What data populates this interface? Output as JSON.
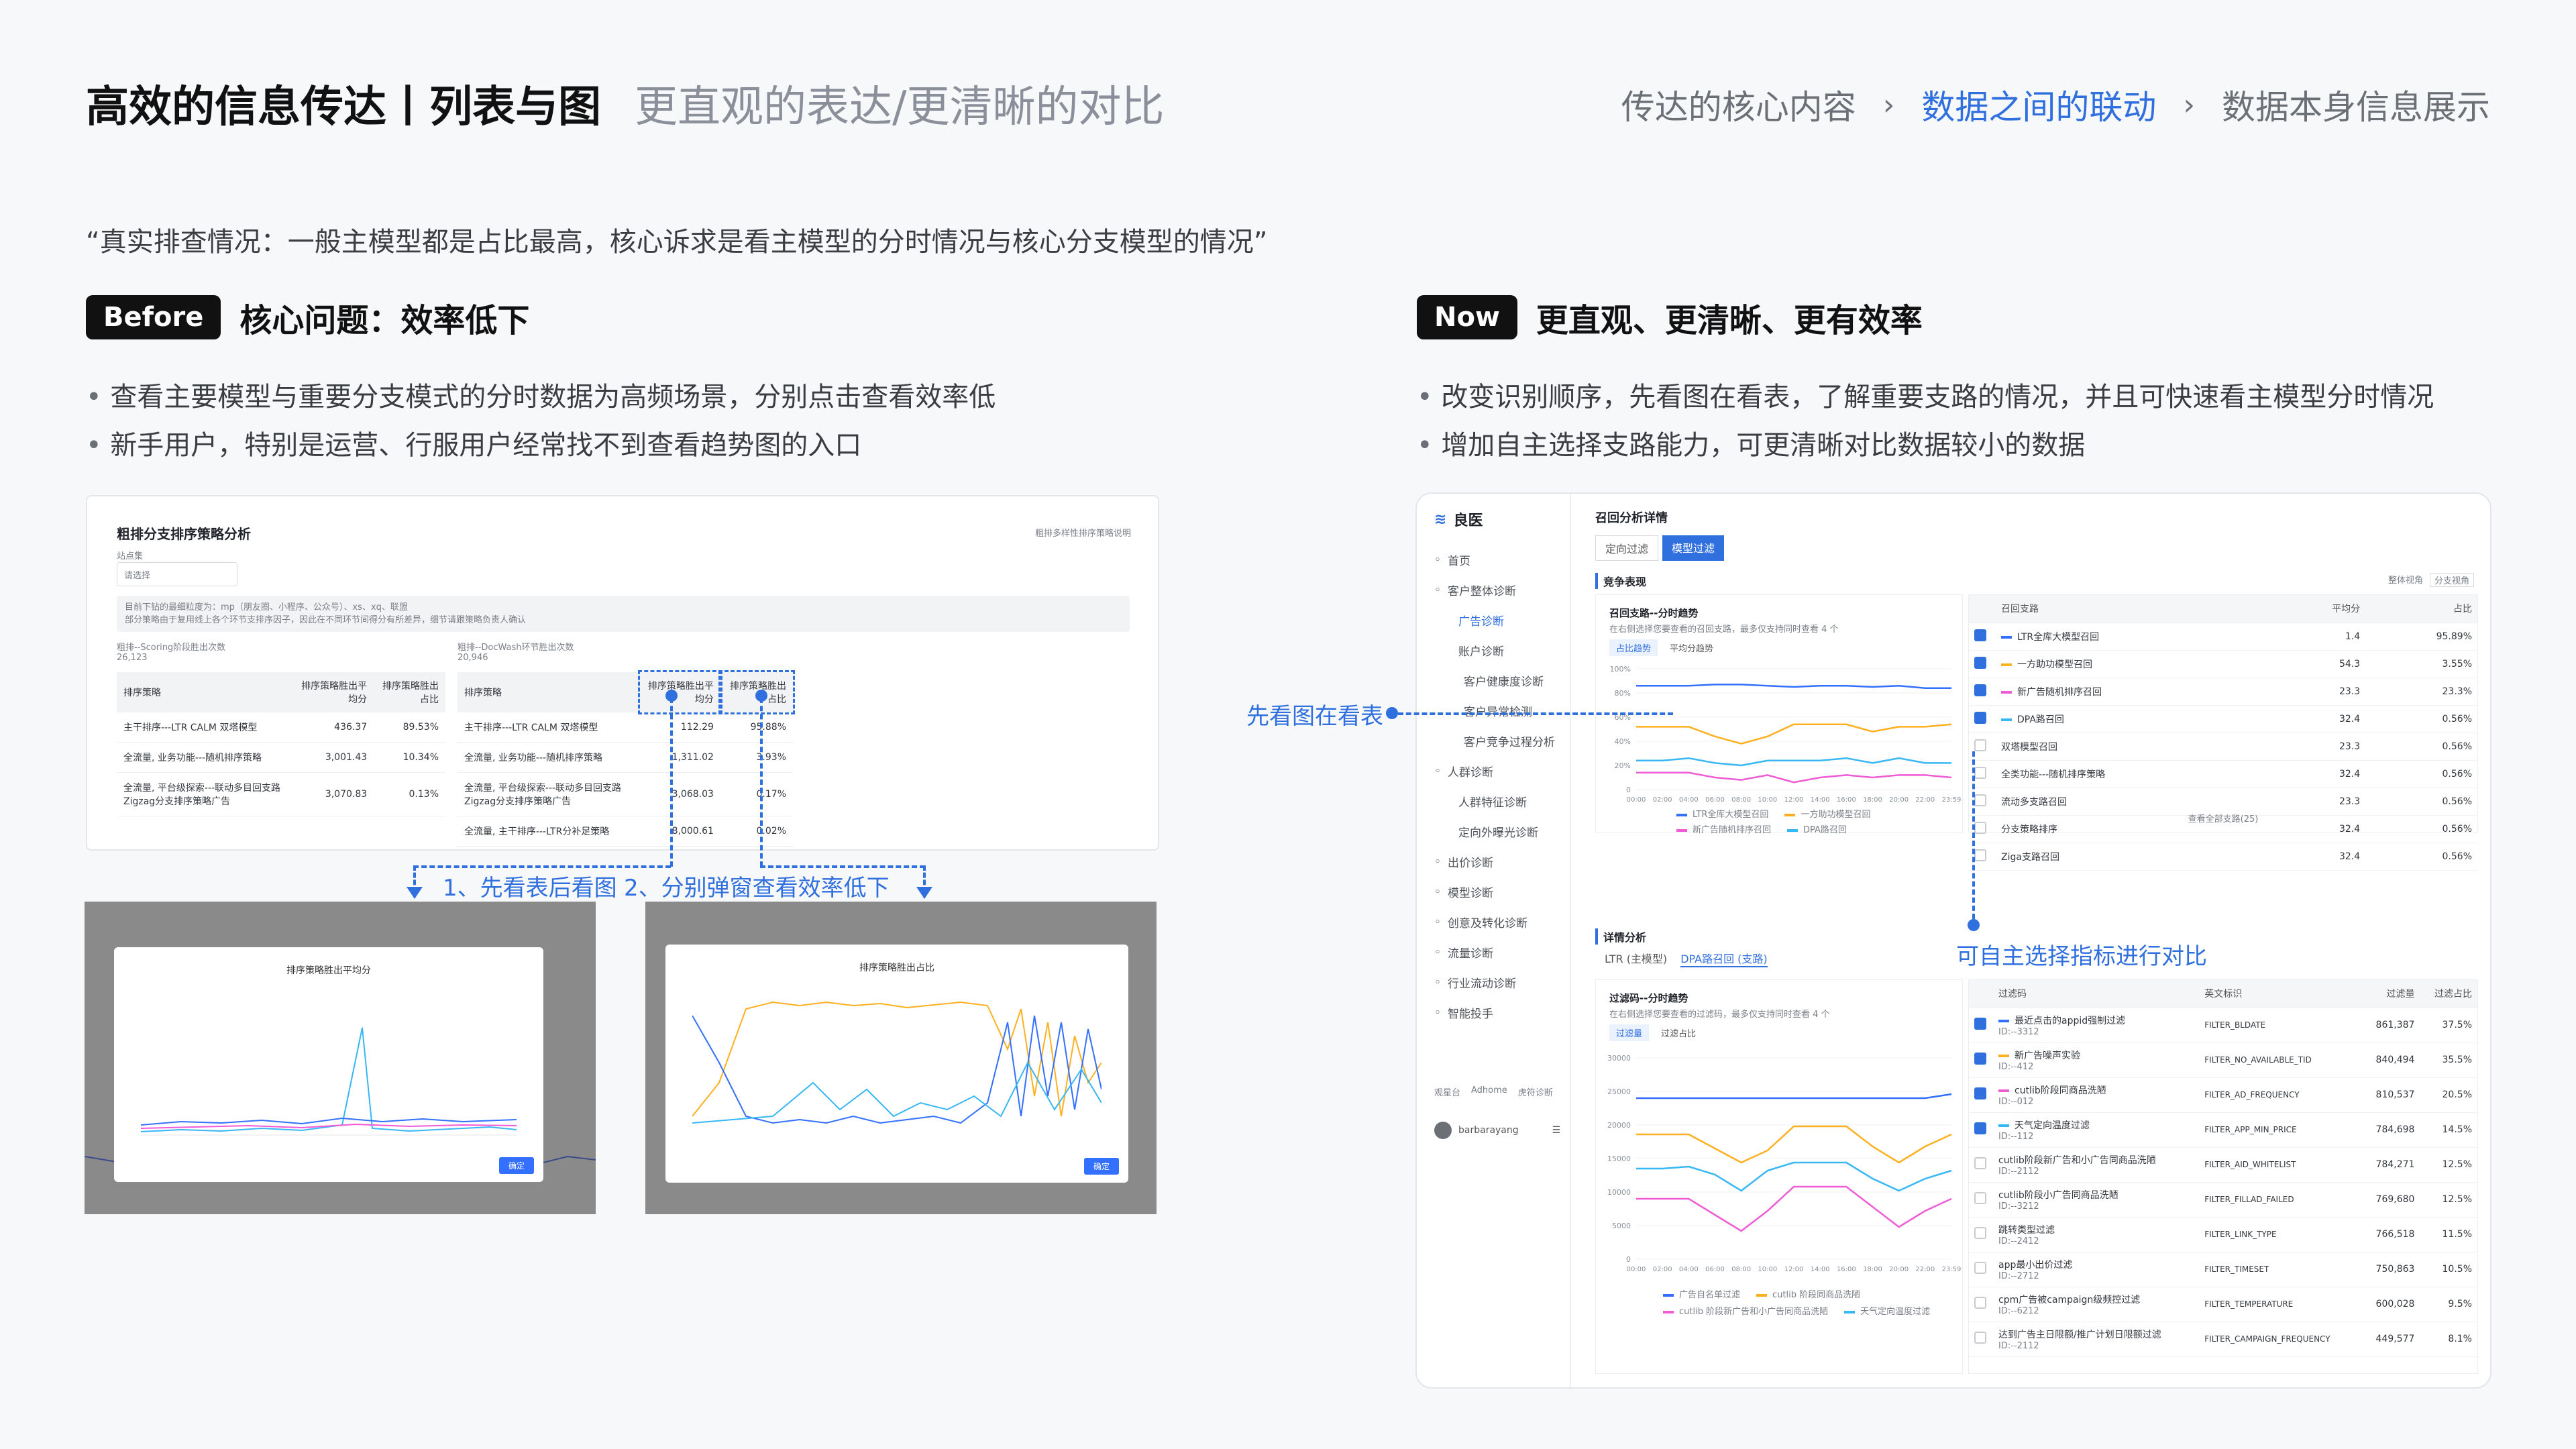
{
  "header": {
    "title": "高效的信息传达丨列表与图",
    "subtitle": "更直观的表达/更清晰的对比",
    "breadcrumbs": [
      "传达的核心内容",
      "数据之间的联动",
      "数据本身信息展示"
    ],
    "breadcrumb_sep": "›"
  },
  "quote": "“真实排查情况：一般主模型都是占比最高，核心诉求是看主模型的分时情况与核心分支模型的情况”",
  "before": {
    "tag": "Before",
    "heading": "核心问题：效率低下",
    "bullets": [
      "查看主要模型与重要分支模式的分时数据为高频场景，分别点击查看效率低",
      "新手用户，特别是运营、行服用户经常找不到查看趋势图的入口"
    ],
    "callout_1": "1、先看表后看图",
    "callout_2": "2、分别弹窗查看效率低下",
    "shot": {
      "title": "粗排分支排序策略分析",
      "help_link": "粗排多样性排序策略说明",
      "filter_label": "站点集",
      "filter_placeholder": "请选择",
      "info_line_1": "目前下钻的最细粒度为：mp（朋友圈、小程序、公众号）、xs、xq、联盟",
      "info_line_2": "部分策略由于复用线上各个环节支排序因子，因此在不同环节间得分有所差异，细节请跟策略负责人确认",
      "left_block": {
        "label": "粗排--Scoring阶段胜出次数",
        "count": "26,123",
        "headers": [
          "排序策略",
          "排序策略胜出平均分",
          "排序策略胜出占比"
        ],
        "rows": [
          [
            "主干排序---LTR CALM 双塔模型",
            "436.37",
            "89.53%"
          ],
          [
            "全流量, 业务功能---随机排序策略",
            "3,001.43",
            "10.34%"
          ],
          [
            "全流量, 平台级探索---联动多目回支路Zigzag分支排序策略广告",
            "3,070.83",
            "0.13%"
          ]
        ]
      },
      "right_block": {
        "label": "粗排--DocWash环节胜出次数",
        "count": "20,946",
        "headers": [
          "排序策略",
          "排序策略胜出平均分",
          "排序策略胜出占比"
        ],
        "rows": [
          [
            "主干排序---LTR CALM 双塔模型",
            "112.29",
            "95.88%"
          ],
          [
            "全流量, 业务功能---随机排序策略",
            "1,311.02",
            "3.93%"
          ],
          [
            "全流量, 平台级探索---联动多目回支路Zigzag分支排序策略广告",
            "3,068.03",
            "0.17%"
          ],
          [
            "全流量, 主干排序---LTR分补足策略",
            "8,000.61",
            "0.02%"
          ]
        ]
      },
      "modal_1": {
        "title": "排序策略胜出平均分",
        "button": "确定"
      },
      "modal_2": {
        "title": "排序策略胜出占比",
        "button": "确定"
      }
    }
  },
  "now": {
    "tag": "Now",
    "heading": "更直观、更清晰、更有效率",
    "bullets": [
      "改变识别顺序，先看图在看表，了解重要支路的情况，并且可快速看主模型分时情况",
      "增加自主选择支路能力，可更清晰对比数据较小的数据"
    ],
    "callout_left": "先看图在看表",
    "callout_right": "可自主选择指标进行对比",
    "app": {
      "logo": "良医",
      "nav": [
        {
          "label": "首页",
          "icon": "home-icon",
          "level": 0
        },
        {
          "label": "客户整体诊断",
          "icon": "chart-icon",
          "level": 0
        },
        {
          "label": "广告诊断",
          "level": 1,
          "active": true
        },
        {
          "label": "账户诊断",
          "level": 1
        },
        {
          "label": "客户健康度诊断",
          "level": 2
        },
        {
          "label": "客户异常检测",
          "level": 2
        },
        {
          "label": "客户竞争过程分析",
          "level": 2
        },
        {
          "label": "人群诊断",
          "icon": "users-icon",
          "level": 0
        },
        {
          "label": "人群特征诊断",
          "level": 1
        },
        {
          "label": "定向外曝光诊断",
          "level": 1
        },
        {
          "label": "出价诊断",
          "icon": "bid-icon",
          "level": 0
        },
        {
          "label": "模型诊断",
          "icon": "model-icon",
          "level": 0
        },
        {
          "label": "创意及转化诊断",
          "icon": "creative-icon",
          "level": 0
        },
        {
          "label": "流量诊断",
          "icon": "traffic-icon",
          "level": 0
        },
        {
          "label": "行业流动诊断",
          "icon": "industry-icon",
          "level": 0
        },
        {
          "label": "智能投手",
          "icon": "robot-icon",
          "level": 0
        }
      ],
      "footer_links": [
        "观星台",
        "Adhome",
        "虎符诊断"
      ],
      "user": "barbarayang",
      "page_title": "召回分析详情",
      "page_tabs": [
        "定向过滤",
        "模型过滤"
      ],
      "section_1": "竞争表现",
      "section_1_right": [
        "整体视角",
        "分支视角"
      ],
      "chart_1": {
        "title": "召回支路--分时趋势",
        "hint": "在右侧选择您要查看的召回支路，最多仅支持同时查看 4 个",
        "tabs": [
          "占比趋势",
          "平均分趋势"
        ],
        "yticks": [
          "100%",
          "80%",
          "60%",
          "40%",
          "20%",
          "0"
        ],
        "xticks": [
          "00:00",
          "02:00",
          "04:00",
          "06:00",
          "08:00",
          "10:00",
          "12:00",
          "14:00",
          "16:00",
          "18:00",
          "20:00",
          "22:00",
          "23:59"
        ],
        "legend": [
          "LTR全库大模型召回",
          "一方助功模型召回",
          "新广告随机排序召回",
          "DPA路召回"
        ],
        "colors": [
          "#3370ff",
          "#ffb020",
          "#f05bd6",
          "#37b7f5"
        ]
      },
      "table_1": {
        "headers": [
          "召回支路",
          "平均分",
          "占比"
        ],
        "rows": [
          {
            "name": "LTR全库大模型召回",
            "avg": "1.4",
            "share": "95.89%",
            "checked": true,
            "color": "#3370ff"
          },
          {
            "name": "一方助功模型召回",
            "avg": "54.3",
            "share": "3.55%",
            "checked": true,
            "color": "#ffb020"
          },
          {
            "name": "新广告随机排序召回",
            "avg": "23.3",
            "share": "23.3%",
            "checked": true,
            "color": "#f05bd6"
          },
          {
            "name": "DPA路召回",
            "avg": "32.4",
            "share": "0.56%",
            "checked": true,
            "color": "#37b7f5"
          },
          {
            "name": "双塔模型召回",
            "avg": "23.3",
            "share": "0.56%",
            "checked": false
          },
          {
            "name": "全类功能---随机排序策略",
            "avg": "32.4",
            "share": "0.56%",
            "checked": false
          },
          {
            "name": "流动多支路召回",
            "avg": "23.3",
            "share": "0.56%",
            "checked": false
          },
          {
            "name": "分支策略排序",
            "avg": "32.4",
            "share": "0.56%",
            "checked": false
          },
          {
            "name": "Ziga支路召回",
            "avg": "32.4",
            "share": "0.56%",
            "checked": false
          }
        ],
        "more": "查看全部支路(25)"
      },
      "section_2": "详情分析",
      "detail_tabs": [
        "LTR (主模型)",
        "DPA路召回 (支路)"
      ],
      "chart_2": {
        "title": "过滤码--分时趋势",
        "hint": "在右侧选择您要查看的过滤码，最多仅支持同时查看 4 个",
        "tabs": [
          "过滤量",
          "过滤占比"
        ],
        "yticks": [
          "30000",
          "25000",
          "20000",
          "15000",
          "10000",
          "5000",
          "0"
        ],
        "xticks": [
          "00:00",
          "02:00",
          "04:00",
          "06:00",
          "08:00",
          "10:00",
          "12:00",
          "14:00",
          "16:00",
          "18:00",
          "20:00",
          "22:00",
          "23:59"
        ],
        "legend": [
          "广告自名单过滤",
          "cutlib 阶段同商品洗陋",
          "cutlib 阶段新广告和小广告同商品洗陋",
          "天气定向温度过滤"
        ],
        "colors": [
          "#3370ff",
          "#ffb020",
          "#f05bd6",
          "#37b7f5"
        ]
      },
      "table_2": {
        "headers": [
          "过滤码",
          "英文标识",
          "过滤量",
          "过滤占比"
        ],
        "rows": [
          {
            "name": "最近点击的appid强制过滤",
            "id": "ID:--3312",
            "en": "FILTER_BLDATE",
            "qty": "861,387",
            "pct": "37.5%",
            "checked": true,
            "color": "#3370ff"
          },
          {
            "name": "新广告噪声实验",
            "id": "ID:--412",
            "en": "FILTER_NO_AVAILABLE_TID",
            "qty": "840,494",
            "pct": "35.5%",
            "checked": true,
            "color": "#ffb020"
          },
          {
            "name": "cutlib阶段同商品洗陋",
            "id": "ID:--012",
            "en": "FILTER_AD_FREQUENCY",
            "qty": "810,537",
            "pct": "20.5%",
            "checked": true,
            "color": "#f05bd6"
          },
          {
            "name": "天气定向温度过滤",
            "id": "ID:--112",
            "en": "FILTER_APP_MIN_PRICE",
            "qty": "784,698",
            "pct": "14.5%",
            "checked": true,
            "color": "#37b7f5"
          },
          {
            "name": "cutlib阶段新广告和小广告同商品洗陋",
            "id": "ID:--2112",
            "en": "FILTER_AID_WHITELIST",
            "qty": "784,271",
            "pct": "12.5%",
            "checked": false
          },
          {
            "name": "cutlib阶段小广告同商品洗陋",
            "id": "ID:--3212",
            "en": "FILTER_FILLAD_FAILED",
            "qty": "769,680",
            "pct": "12.5%",
            "checked": false
          },
          {
            "name": "跳转类型过滤",
            "id": "ID:--2412",
            "en": "FILTER_LINK_TYPE",
            "qty": "766,518",
            "pct": "11.5%",
            "checked": false
          },
          {
            "name": "app最小出价过滤",
            "id": "ID:--2712",
            "en": "FILTER_TIMESET",
            "qty": "750,863",
            "pct": "10.5%",
            "checked": false
          },
          {
            "name": "cpm广告被campaign级频控过滤",
            "id": "ID:--6212",
            "en": "FILTER_TEMPERATURE",
            "qty": "600,028",
            "pct": "9.5%",
            "checked": false
          },
          {
            "name": "达到广告主日限额/推广计划日限额过滤",
            "id": "ID:--2112",
            "en": "FILTER_CAMPAIGN_FREQUENCY",
            "qty": "449,577",
            "pct": "8.1%",
            "checked": false
          }
        ]
      }
    }
  }
}
